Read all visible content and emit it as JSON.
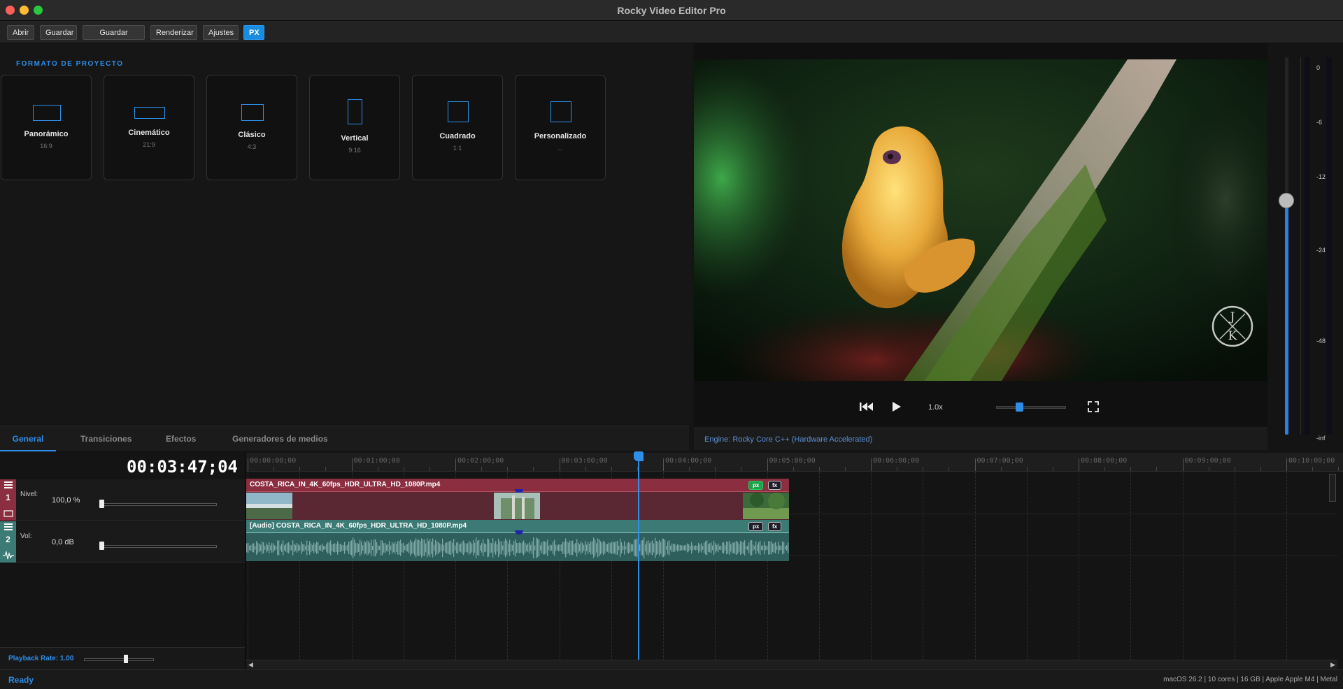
{
  "window": {
    "title": "Rocky Video Editor Pro"
  },
  "toolbar": {
    "abrir": "Abrir",
    "guardar": "Guardar",
    "guardar_como": "Guardar como...",
    "renderizar": "Renderizar",
    "ajustes": "Ajustes",
    "px": "PX"
  },
  "formats": {
    "section_title": "FORMATO DE PROYECTO",
    "cards": [
      {
        "name": "Panorámico",
        "ratio": "16:9"
      },
      {
        "name": "Cinemático",
        "ratio": "21:9"
      },
      {
        "name": "Clásico",
        "ratio": "4:3"
      },
      {
        "name": "Vertical",
        "ratio": "9:16"
      },
      {
        "name": "Cuadrado",
        "ratio": "1:1"
      },
      {
        "name": "Personalizado",
        "ratio": "..."
      }
    ]
  },
  "preview": {
    "speed": "1.0x",
    "engine": "Engine: Rocky Core C++ (Hardware Accelerated)",
    "logo_letters": "JK"
  },
  "meter": {
    "labels": [
      "0",
      "-6",
      "-12",
      "-24",
      "-48",
      "-inf"
    ],
    "volume_level": 0.62
  },
  "tabs": [
    "General",
    "Transiciones",
    "Efectos",
    "Generadores de medios"
  ],
  "timeline": {
    "timecode": "00:03:47;04",
    "ruler": [
      "00:00:00;00",
      "00:01:00;00",
      "00:02:00;00",
      "00:03:00;00",
      "00:04:00;00",
      "00:05:00;00",
      "00:06:00;00",
      "00:07:00;00",
      "00:08:00;00",
      "00:09:00;00",
      "00:10:00;00"
    ],
    "tracks": [
      {
        "number": "1",
        "label": "Nivel:",
        "value": "100,0 %"
      },
      {
        "number": "2",
        "label": "Vol:",
        "value": "0,0 dB"
      }
    ],
    "video_clip": {
      "name": "COSTA_RICA_IN_4K_60fps_HDR_ULTRA_HD_1080P.mp4",
      "badge_px": "px",
      "badge_fx": "fx"
    },
    "audio_clip": {
      "name": "[Audio] COSTA_RICA_IN_4K_60fps_HDR_ULTRA_HD_1080P.mp4",
      "badge_px": "px",
      "badge_fx": "fx"
    }
  },
  "playback": {
    "label": "Playback Rate: 1.00"
  },
  "status": {
    "ready": "Ready",
    "system": "macOS 26.2 | 10 cores | 16 GB | Apple Apple M4 | Metal"
  },
  "colors": {
    "accent": "#2e8ee8",
    "video_track": "#8b2e40",
    "audio_track": "#3c7a75"
  }
}
